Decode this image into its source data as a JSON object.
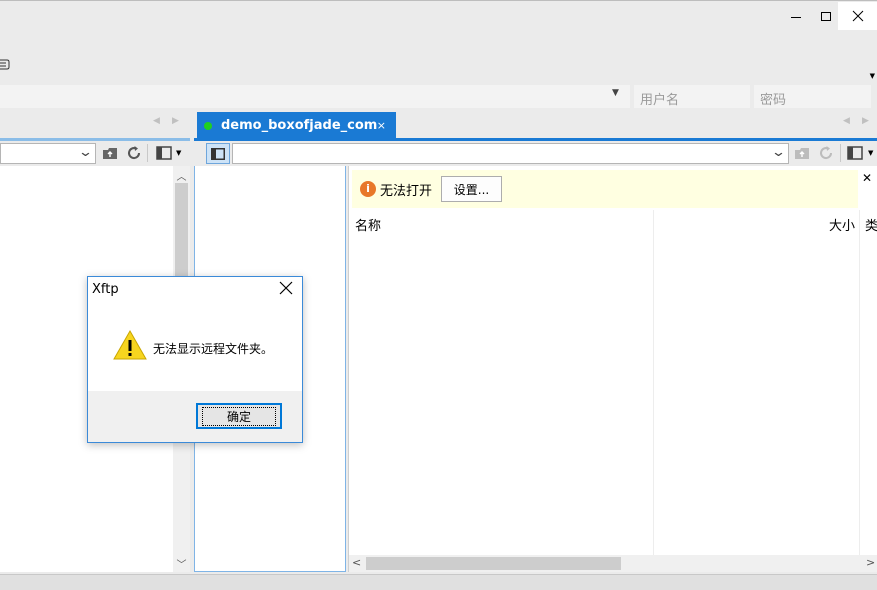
{
  "window": {
    "min_icon": "minimize-icon",
    "max_icon": "maximize-icon",
    "close_icon": "close-icon"
  },
  "address": {
    "username_placeholder": "用户名",
    "password_placeholder": "密码"
  },
  "remote": {
    "tab_label": "demo_boxofjade_com",
    "tab_status_color": "#20d020",
    "info_message": "无法打开",
    "settings_button": "设置...",
    "columns": [
      "名称",
      "大小",
      "类"
    ]
  },
  "dialog": {
    "title": "Xftp",
    "message": "无法显示远程文件夹。",
    "ok_button": "确定"
  },
  "colors": {
    "accent": "#1a7ad4",
    "info_bg": "#ffffe1",
    "warning": "#f7d51f"
  }
}
